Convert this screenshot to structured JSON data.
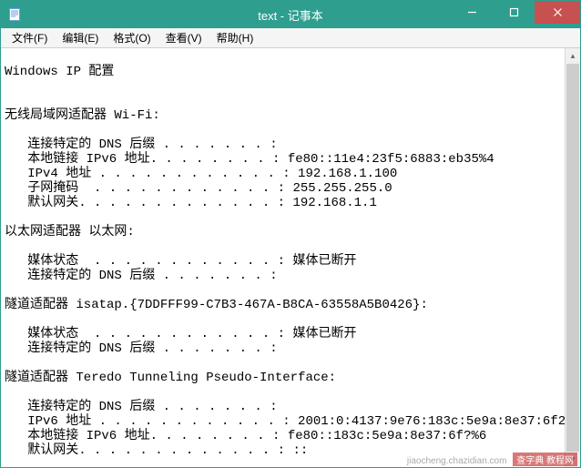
{
  "window": {
    "title": "text - 记事本",
    "minimize_tip": "Minimize",
    "maximize_tip": "Maximize",
    "close_tip": "Close"
  },
  "menu": {
    "file": "文件(F)",
    "edit": "编辑(E)",
    "format": "格式(O)",
    "view": "查看(V)",
    "help": "帮助(H)"
  },
  "body_text": "\nWindows IP 配置\n\n\n无线局域网适配器 Wi-Fi:\n\n   连接特定的 DNS 后缀 . . . . . . . :\n   本地链接 IPv6 地址. . . . . . . . : fe80::11e4:23f5:6883:eb35%4\n   IPv4 地址 . . . . . . . . . . . . : 192.168.1.100\n   子网掩码  . . . . . . . . . . . . : 255.255.255.0\n   默认网关. . . . . . . . . . . . . : 192.168.1.1\n\n以太网适配器 以太网:\n\n   媒体状态  . . . . . . . . . . . . : 媒体已断开\n   连接特定的 DNS 后缀 . . . . . . . :\n\n隧道适配器 isatap.{7DDFFF99-C7B3-467A-B8CA-63558A5B0426}:\n\n   媒体状态  . . . . . . . . . . . . : 媒体已断开\n   连接特定的 DNS 后缀 . . . . . . . :\n\n隧道适配器 Teredo Tunneling Pseudo-Interface:\n\n   连接特定的 DNS 后缀 . . . . . . . :\n   IPv6 地址 . . . . . . . . . . . . : 2001:0:4137:9e76:183c:5e9a:8e37:6f2\n   本地链接 IPv6 地址. . . . . . . . : fe80::183c:5e9a:8e37:6f?%6\n   默认网关. . . . . . . . . . . . . : ::",
  "watermark": {
    "url": "jiaocheng.chazidian.com",
    "label": "查字典 教程网"
  }
}
